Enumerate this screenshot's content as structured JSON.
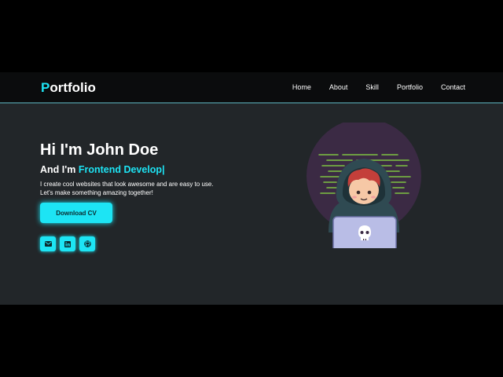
{
  "header": {
    "logo_initial": "P",
    "logo_rest": "ortfolio",
    "nav": [
      "Home",
      "About",
      "Skill",
      "Portfolio",
      "Contact"
    ]
  },
  "hero": {
    "title": "Hi I'm John Doe",
    "subtitle_prefix": "And I'm ",
    "subtitle_role": "Frontend Develop|",
    "description": "I create cool websites that look awesome and are easy to use. Let's make something amazing together!",
    "cta_label": "Download CV",
    "social_icons": [
      "mail-icon",
      "linkedin-icon",
      "github-icon"
    ]
  },
  "colors": {
    "accent": "#1de4f4",
    "background": "#222629",
    "navbar": "#0b0c0d"
  }
}
